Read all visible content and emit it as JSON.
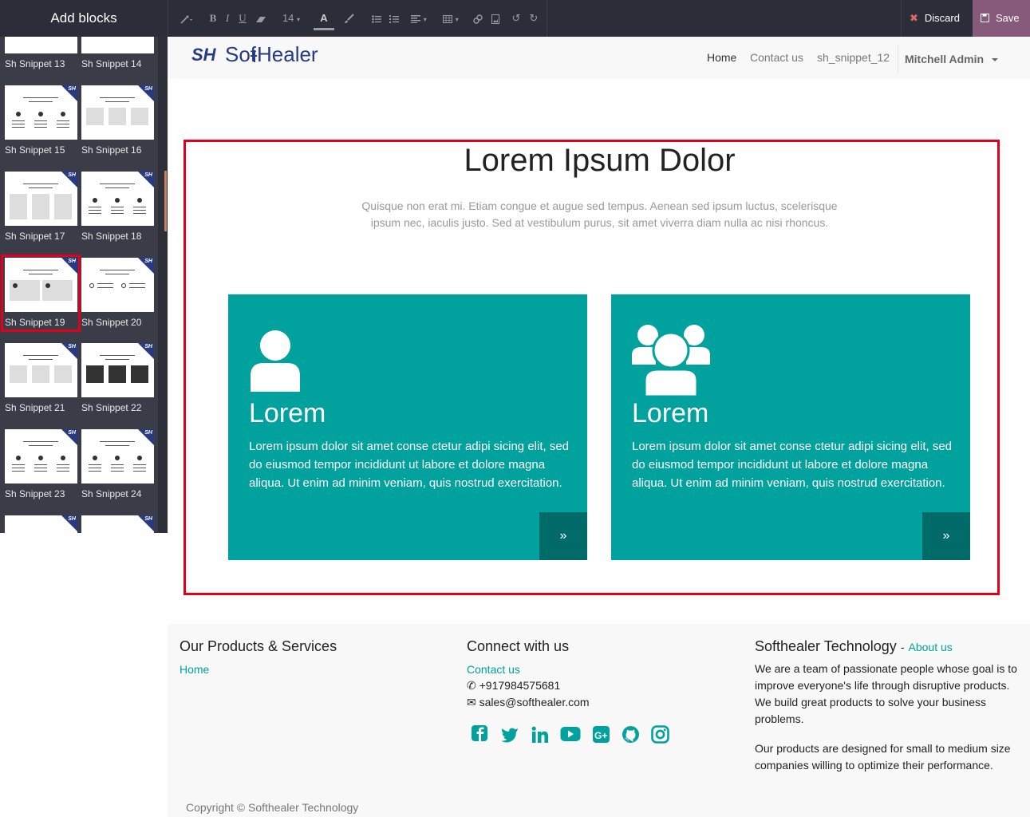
{
  "topbar": {
    "title": "Add blocks",
    "font_size": "14",
    "discard_label": "Discard",
    "save_label": "Save",
    "icons": [
      "magic-icon",
      "bold-icon",
      "italic-icon",
      "underline-icon",
      "eraser-icon",
      "font-size-dropdown",
      "font-color-icon",
      "paint-brush-icon",
      "unordered-list-icon",
      "ordered-list-icon",
      "align-icon",
      "table-icon",
      "link-icon",
      "image-icon",
      "undo-icon",
      "redo-icon"
    ]
  },
  "sidebar": {
    "snippets": [
      {
        "label": "Sh Snippet 13"
      },
      {
        "label": "Sh Snippet 14"
      },
      {
        "label": "Sh Snippet 15"
      },
      {
        "label": "Sh Snippet 16"
      },
      {
        "label": "Sh Snippet 17"
      },
      {
        "label": "Sh Snippet 18"
      },
      {
        "label": "Sh Snippet 19"
      },
      {
        "label": "Sh Snippet 20"
      },
      {
        "label": "Sh Snippet 21"
      },
      {
        "label": "Sh Snippet 22"
      },
      {
        "label": "Sh Snippet 23"
      },
      {
        "label": "Sh Snippet 24"
      }
    ],
    "selected": "Sh Snippet 19"
  },
  "header": {
    "logo_text": "SoftHealer",
    "nav": [
      {
        "label": "Home"
      },
      {
        "label": "Contact us"
      },
      {
        "label": "sh_snippet_12"
      }
    ],
    "user": "Mitchell Admin"
  },
  "section": {
    "title": "Lorem Ipsum Dolor",
    "subtitle": "Quisque non erat mi. Etiam congue et augue sed tempus. Aenean sed ipsum luctus, scelerisque ipsum nec, iaculis justo. Sed at vestibulum purus, sit amet viverra diam nulla ac nisi rhoncus.",
    "cards": [
      {
        "title": "Lorem",
        "icon": "user-icon",
        "text": "Lorem ipsum dolor sit amet conse ctetur adipi sicing elit, sed do eiusmod tempor incididunt ut labore et dolore magna aliqua. Ut enim ad minim veniam, quis nostrud exercitation.",
        "arrow": "»"
      },
      {
        "title": "Lorem",
        "icon": "users-icon",
        "text": "Lorem ipsum dolor sit amet conse ctetur adipi sicing elit, sed do eiusmod tempor incididunt ut labore et dolore magna aliqua. Ut enim ad minim veniam, quis nostrud exercitation.",
        "arrow": "»"
      }
    ]
  },
  "footer": {
    "col1": {
      "title": "Our Products & Services",
      "link": "Home"
    },
    "col2": {
      "title": "Connect with us",
      "link": "Contact us",
      "phone": "+917984575681",
      "email": "sales@softhealer.com",
      "social": [
        "facebook-icon",
        "twitter-icon",
        "linkedin-icon",
        "youtube-icon",
        "google-plus-icon",
        "github-icon",
        "instagram-icon"
      ]
    },
    "col3": {
      "title": "Softhealer Technology",
      "separator": "-",
      "link": "About us",
      "p1": "We are a team of passionate people whose goal is to improve everyone's life through disruptive products. We build great products to solve your business problems.",
      "p2": "Our products are designed for small to medium size companies willing to optimize their performance."
    },
    "copyright": "Copyright © Softhealer Technology"
  },
  "colors": {
    "teal": "#01a29e",
    "dark_teal": "#006b69",
    "topbar": "#2b2e39",
    "save": "#875a7b",
    "selection": "#e0001b"
  }
}
